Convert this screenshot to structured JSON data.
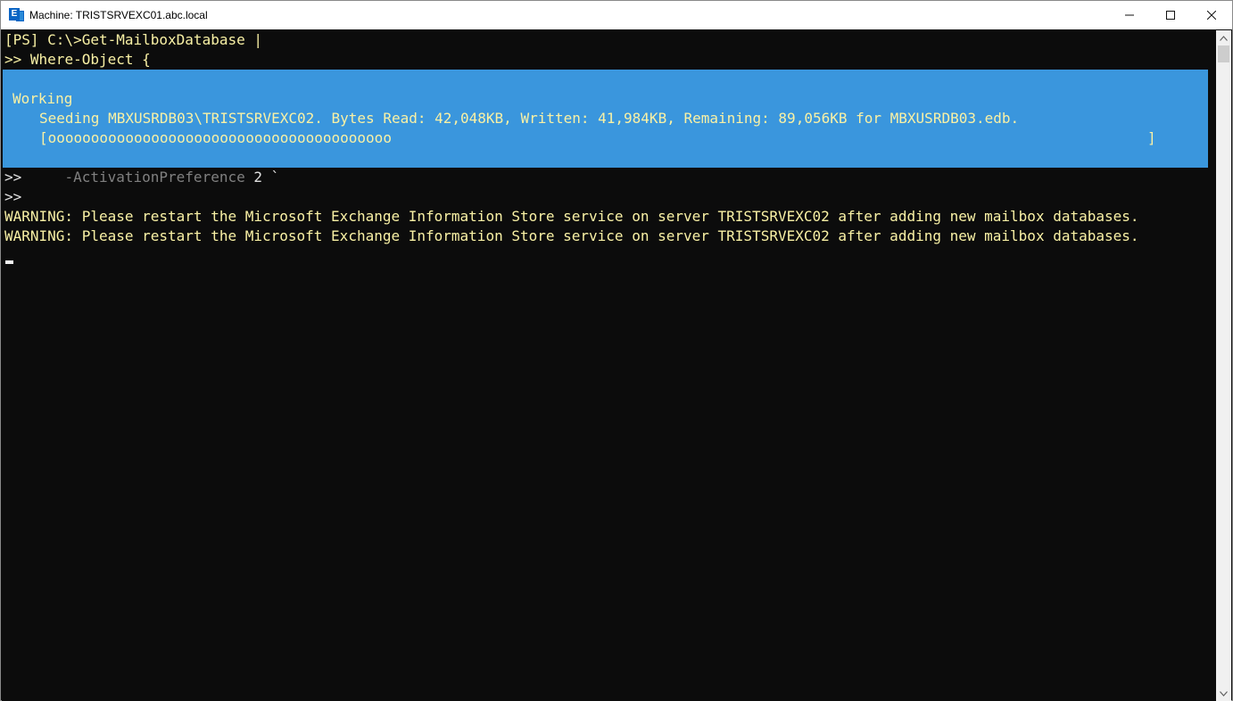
{
  "window": {
    "title": "Machine: TRISTSRVEXC01.abc.local",
    "icon_letter": "E",
    "controls": [
      "minimize-icon",
      "maximize-icon",
      "close-icon"
    ]
  },
  "console": {
    "prompt_line": {
      "prefix": "[PS] C:\\>",
      "command": "Get-MailboxDatabase |"
    },
    "cont_line_1": {
      "prefix": ">> ",
      "text": "Where-Object {"
    },
    "progress": {
      "activity": "Working",
      "status": "Seeding MBXUSRDB03\\TRISTSRVEXC02. Bytes Read: 42,048KB, Written: 41,984KB, Remaining: 89,056KB for MBXUSRDB03.edb.",
      "bar_fill": "[oooooooooooooooooooooooooooooooooooooooo",
      "bar_end": "]"
    },
    "cont_line_2": {
      "prefix": ">>     ",
      "param": "-ActivationPreference",
      "value": " 2 `"
    },
    "cont_line_3": {
      "prefix": ">>"
    },
    "warnings": [
      "WARNING: Please restart the Microsoft Exchange Information Store service on server TRISTSRVEXC02 after adding new mailbox databases.",
      "WARNING: Please restart the Microsoft Exchange Information Store service on server TRISTSRVEXC02 after adding new mailbox databases."
    ]
  },
  "colors": {
    "console_bg": "#0c0c0c",
    "progress_bg": "#3a96dd",
    "warning_text": "#f9f1a5",
    "default_text": "#cccccc"
  }
}
